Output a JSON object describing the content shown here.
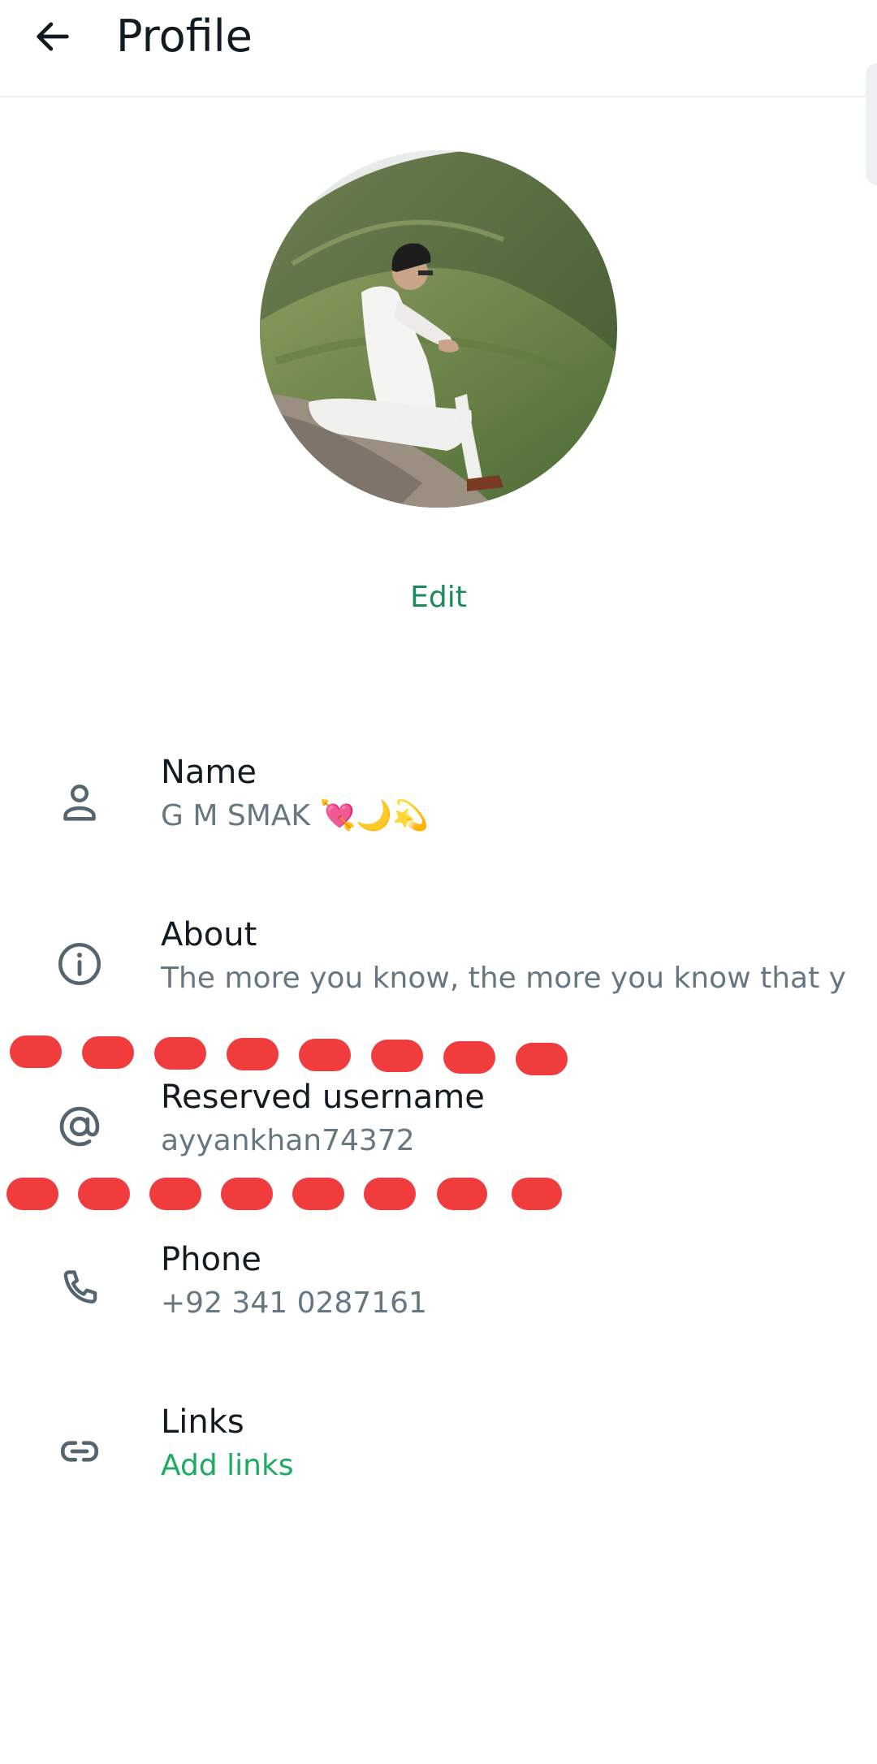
{
  "header": {
    "title": "Profile",
    "back_icon": "arrow-left-icon"
  },
  "profile": {
    "photo_icon": "profile-photo",
    "edit_label": "Edit"
  },
  "fields": {
    "name": {
      "label": "Name",
      "value_text": "G M SMAK ",
      "emoji_heart": "💘",
      "emoji_moon": "🌙",
      "emoji_star": "💫",
      "icon": "person-icon"
    },
    "about": {
      "label": "About",
      "value": "The more you know, the more you know that y",
      "icon": "info-icon"
    },
    "username": {
      "label": "Reserved username",
      "value": "ayyankhan74372",
      "icon": "at-sign-icon"
    },
    "phone": {
      "label": "Phone",
      "value": "+92 341 0287161",
      "icon": "phone-icon"
    },
    "links": {
      "label": "Links",
      "value": "Add links",
      "icon": "link-icon"
    }
  },
  "colors": {
    "accent": "#1daa61",
    "edit": "#1d8a5a",
    "secondary_text": "#667781",
    "redaction": "#f03c3c"
  }
}
